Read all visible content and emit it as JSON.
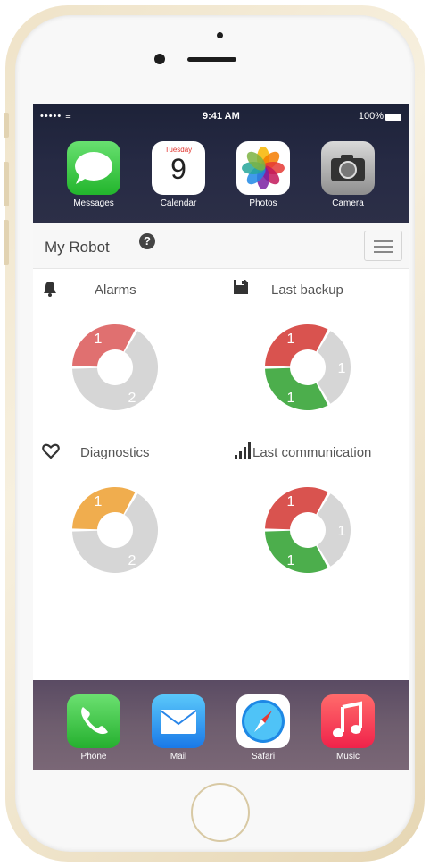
{
  "status_bar": {
    "signal": "••••• ≡",
    "time": "9:41 AM",
    "battery": "100%"
  },
  "home_apps": [
    {
      "label": "Messages",
      "icon": "messages-icon"
    },
    {
      "label": "Calendar",
      "icon": "calendar-icon",
      "day_name": "Tuesday",
      "day_number": "9"
    },
    {
      "label": "Photos",
      "icon": "photos-icon"
    },
    {
      "label": "Camera",
      "icon": "camera-icon"
    }
  ],
  "dock_apps": [
    {
      "label": "Phone",
      "icon": "phone-icon"
    },
    {
      "label": "Mail",
      "icon": "mail-icon"
    },
    {
      "label": "Safari",
      "icon": "safari-icon"
    },
    {
      "label": "Music",
      "icon": "music-icon"
    }
  ],
  "header": {
    "title": "My Robot",
    "help_icon": "?"
  },
  "widgets": [
    {
      "label": "Alarms",
      "icon": "bell-icon"
    },
    {
      "label": "Last backup",
      "icon": "floppy-icon"
    },
    {
      "label": "Diagnostics",
      "icon": "heart-icon"
    },
    {
      "label": "Last communication",
      "icon": "signal-bars-icon"
    }
  ],
  "colors": {
    "red": "#d9534f",
    "light_red": "#e07070",
    "gray": "#d6d6d6",
    "green": "#4cae4c",
    "orange": "#f0ad4e"
  },
  "chart_data": [
    {
      "type": "pie",
      "title": "Alarms",
      "labels": [
        "1",
        "2"
      ],
      "values": [
        1,
        2
      ],
      "colors": [
        "#e07070",
        "#d6d6d6"
      ]
    },
    {
      "type": "pie",
      "title": "Last backup",
      "labels": [
        "1",
        "1",
        "1"
      ],
      "values": [
        1,
        1,
        1
      ],
      "colors": [
        "#d9534f",
        "#d6d6d6",
        "#4cae4c"
      ]
    },
    {
      "type": "pie",
      "title": "Diagnostics",
      "labels": [
        "1",
        "2"
      ],
      "values": [
        1,
        2
      ],
      "colors": [
        "#f0ad4e",
        "#d6d6d6"
      ]
    },
    {
      "type": "pie",
      "title": "Last communication",
      "labels": [
        "1",
        "1",
        "1"
      ],
      "values": [
        1,
        1,
        1
      ],
      "colors": [
        "#d9534f",
        "#d6d6d6",
        "#4cae4c"
      ]
    }
  ]
}
